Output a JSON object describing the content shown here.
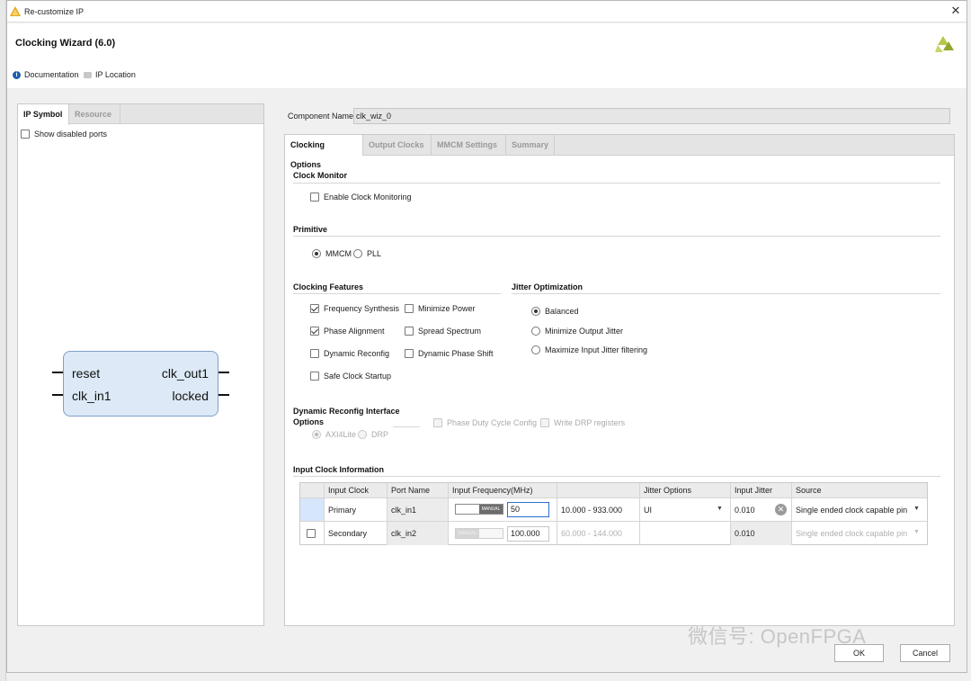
{
  "window": {
    "title": "Re-customize IP",
    "wizard_title": "Clocking Wizard (6.0)",
    "links": {
      "documentation": "Documentation",
      "ip_location": "IP Location"
    }
  },
  "left_panel": {
    "tabs": [
      "IP Symbol",
      "Resource"
    ],
    "active_tab": "IP Symbol",
    "show_disabled_ports": "Show disabled ports",
    "symbol": {
      "left_ports": [
        "reset",
        "clk_in1"
      ],
      "right_ports": [
        "clk_out1",
        "locked"
      ]
    }
  },
  "component": {
    "label": "Component Name",
    "value": "clk_wiz_0"
  },
  "main_tabs": [
    "Clocking Options",
    "Output Clocks",
    "MMCM Settings",
    "Summary"
  ],
  "active_main_tab": "Clocking Options",
  "clock_monitor": {
    "title": "Clock Monitor",
    "enable_label": "Enable Clock Monitoring",
    "enabled": false
  },
  "primitive": {
    "title": "Primitive",
    "options": [
      "MMCM",
      "PLL"
    ],
    "selected": "MMCM"
  },
  "clocking_features": {
    "title": "Clocking Features",
    "col1": [
      {
        "label": "Frequency Synthesis",
        "checked": true
      },
      {
        "label": "Phase Alignment",
        "checked": true
      },
      {
        "label": "Dynamic Reconfig",
        "checked": false
      },
      {
        "label": "Safe Clock Startup",
        "checked": false
      }
    ],
    "col2": [
      {
        "label": "Minimize Power",
        "checked": false
      },
      {
        "label": "Spread Spectrum",
        "checked": false
      },
      {
        "label": "Dynamic Phase Shift",
        "checked": false
      }
    ]
  },
  "jitter_optimization": {
    "title": "Jitter Optimization",
    "options": [
      "Balanced",
      "Minimize Output Jitter",
      "Maximize Input Jitter filtering"
    ],
    "selected": "Balanced"
  },
  "dynamic_reconfig": {
    "title": "Dynamic Reconfig Interface Options",
    "options": [
      "AXI4Lite",
      "DRP"
    ],
    "selected": "AXI4Lite",
    "phase_duty": "Phase Duty Cycle Config",
    "write_drp": "Write DRP registers"
  },
  "input_clock": {
    "title": "Input Clock Information",
    "headers": [
      "Input Clock",
      "Port Name",
      "Input Frequency(MHz)",
      "",
      "Jitter Options",
      "Input Jitter",
      "Source"
    ],
    "toggle_label": "MANUAL",
    "rows": [
      {
        "clock": "Primary",
        "port": "clk_in1",
        "freq": "50",
        "range": "10.000 - 933.000",
        "jitter_option": "UI",
        "jitter": "0.010",
        "source": "Single ended clock capable pin"
      },
      {
        "clock": "Secondary",
        "port": "clk_in2",
        "freq": "100.000",
        "range": "60.000 - 144.000",
        "jitter_option": "",
        "jitter": "0.010",
        "source": "Single ended clock capable pin"
      }
    ]
  },
  "buttons": {
    "ok": "OK",
    "cancel": "Cancel"
  },
  "watermark": "微信号: OpenFPGA"
}
